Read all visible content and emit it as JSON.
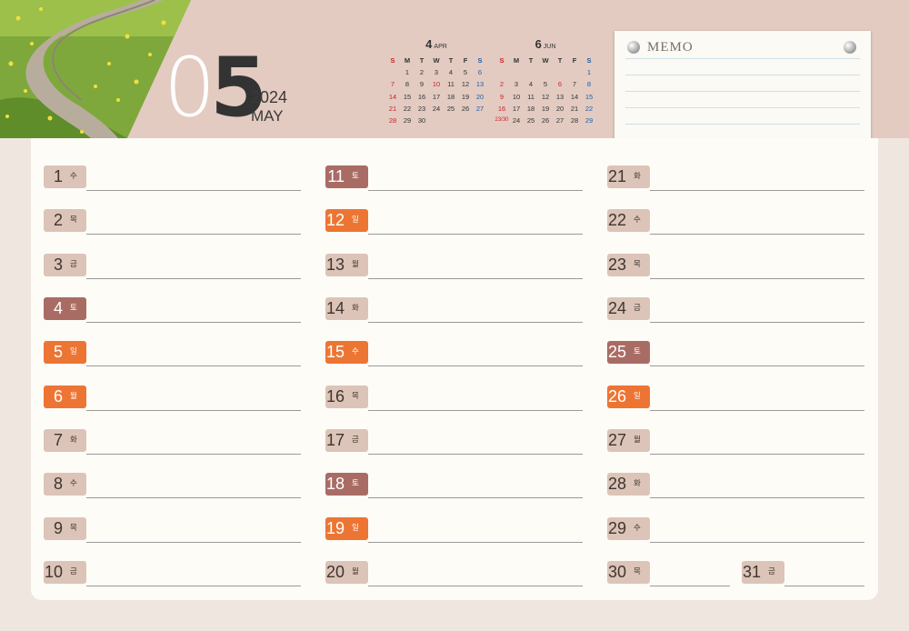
{
  "month": {
    "digit1": "0",
    "digit2": "5",
    "year": "2024",
    "name": "MAY"
  },
  "mini_calendars": [
    {
      "num": "4",
      "abbr": "APR",
      "headers": [
        "S",
        "M",
        "T",
        "W",
        "T",
        "F",
        "S"
      ],
      "weeks": [
        [
          "",
          "1",
          "2",
          "3",
          "4",
          "5",
          "6"
        ],
        [
          "7",
          "8",
          "9",
          "10",
          "11",
          "12",
          "13"
        ],
        [
          "14",
          "15",
          "16",
          "17",
          "18",
          "19",
          "20"
        ],
        [
          "21",
          "22",
          "23",
          "24",
          "25",
          "26",
          "27"
        ],
        [
          "28",
          "29",
          "30",
          "",
          "",
          "",
          ""
        ]
      ],
      "red_days": [
        "10"
      ]
    },
    {
      "num": "6",
      "abbr": "JUN",
      "headers": [
        "S",
        "M",
        "T",
        "W",
        "T",
        "F",
        "S"
      ],
      "weeks": [
        [
          "",
          "",
          "",
          "",
          "",
          "",
          "1"
        ],
        [
          "2",
          "3",
          "4",
          "5",
          "6",
          "7",
          "8"
        ],
        [
          "9",
          "10",
          "11",
          "12",
          "13",
          "14",
          "15"
        ],
        [
          "16",
          "17",
          "18",
          "19",
          "20",
          "21",
          "22"
        ],
        [
          "23/30",
          "24",
          "25",
          "26",
          "27",
          "28",
          "29"
        ]
      ],
      "red_days": [
        "6"
      ]
    }
  ],
  "memo": {
    "title": "MEMO"
  },
  "days": [
    {
      "num": "1",
      "dow": "수",
      "type": "weekday"
    },
    {
      "num": "2",
      "dow": "목",
      "type": "weekday"
    },
    {
      "num": "3",
      "dow": "금",
      "type": "weekday"
    },
    {
      "num": "4",
      "dow": "토",
      "type": "sat"
    },
    {
      "num": "5",
      "dow": "일",
      "type": "sun"
    },
    {
      "num": "6",
      "dow": "월",
      "type": "sun"
    },
    {
      "num": "7",
      "dow": "화",
      "type": "weekday"
    },
    {
      "num": "8",
      "dow": "수",
      "type": "weekday"
    },
    {
      "num": "9",
      "dow": "목",
      "type": "weekday"
    },
    {
      "num": "10",
      "dow": "금",
      "type": "weekday"
    },
    {
      "num": "11",
      "dow": "토",
      "type": "sat"
    },
    {
      "num": "12",
      "dow": "일",
      "type": "sun"
    },
    {
      "num": "13",
      "dow": "월",
      "type": "weekday"
    },
    {
      "num": "14",
      "dow": "화",
      "type": "weekday"
    },
    {
      "num": "15",
      "dow": "수",
      "type": "sun"
    },
    {
      "num": "16",
      "dow": "목",
      "type": "weekday"
    },
    {
      "num": "17",
      "dow": "금",
      "type": "weekday"
    },
    {
      "num": "18",
      "dow": "토",
      "type": "sat"
    },
    {
      "num": "19",
      "dow": "일",
      "type": "sun"
    },
    {
      "num": "20",
      "dow": "월",
      "type": "weekday"
    },
    {
      "num": "21",
      "dow": "화",
      "type": "weekday"
    },
    {
      "num": "22",
      "dow": "수",
      "type": "weekday"
    },
    {
      "num": "23",
      "dow": "목",
      "type": "weekday"
    },
    {
      "num": "24",
      "dow": "금",
      "type": "weekday"
    },
    {
      "num": "25",
      "dow": "토",
      "type": "sat"
    },
    {
      "num": "26",
      "dow": "일",
      "type": "sun"
    },
    {
      "num": "27",
      "dow": "월",
      "type": "weekday"
    },
    {
      "num": "28",
      "dow": "화",
      "type": "weekday"
    },
    {
      "num": "29",
      "dow": "수",
      "type": "weekday"
    },
    {
      "num": "30",
      "dow": "목",
      "type": "weekday"
    },
    {
      "num": "31",
      "dow": "금",
      "type": "weekday"
    }
  ],
  "colors": {
    "saturday": "#a96c64",
    "holiday": "#ed7534",
    "weekday": "#dcc4b8",
    "header": "#e3cbc1",
    "sunday_text": "#c8242b",
    "saturday_text": "#1c5ea8"
  }
}
